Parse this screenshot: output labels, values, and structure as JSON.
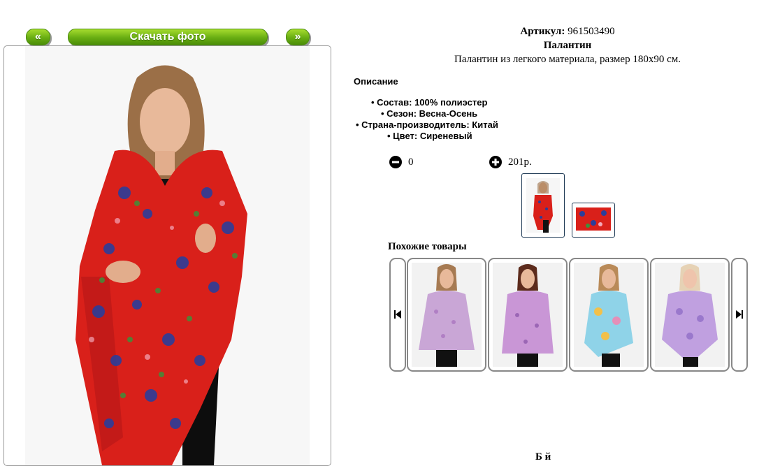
{
  "gallery": {
    "prev_label": "«",
    "next_label": "»",
    "download_label": "Скачать фото"
  },
  "product": {
    "article_label": "Артикул:",
    "article_value": "961503490",
    "name": "Палантин",
    "subtitle": "Палантин из легкого материала, размер 180х90 см."
  },
  "description": {
    "heading": "Описание",
    "items": [
      "• Состав: 100% полиэстер",
      "• Сезон: Весна-Осень",
      "• Страна-производитель: Китай",
      "• Цвет: Сиреневый"
    ]
  },
  "quantity": {
    "minus_icon": "minus-circle-icon",
    "value": "0",
    "plus_icon": "plus-circle-icon",
    "price": "201р."
  },
  "similar": {
    "heading": "Похожие товары",
    "prev_icon": "skip-back-icon",
    "next_icon": "skip-forward-icon"
  },
  "footer": {
    "partial_text": "Б й"
  },
  "colors": {
    "accent_green": "#68ad12",
    "scarf_red": "#d9201a",
    "lilac": "#c9a6d6"
  }
}
